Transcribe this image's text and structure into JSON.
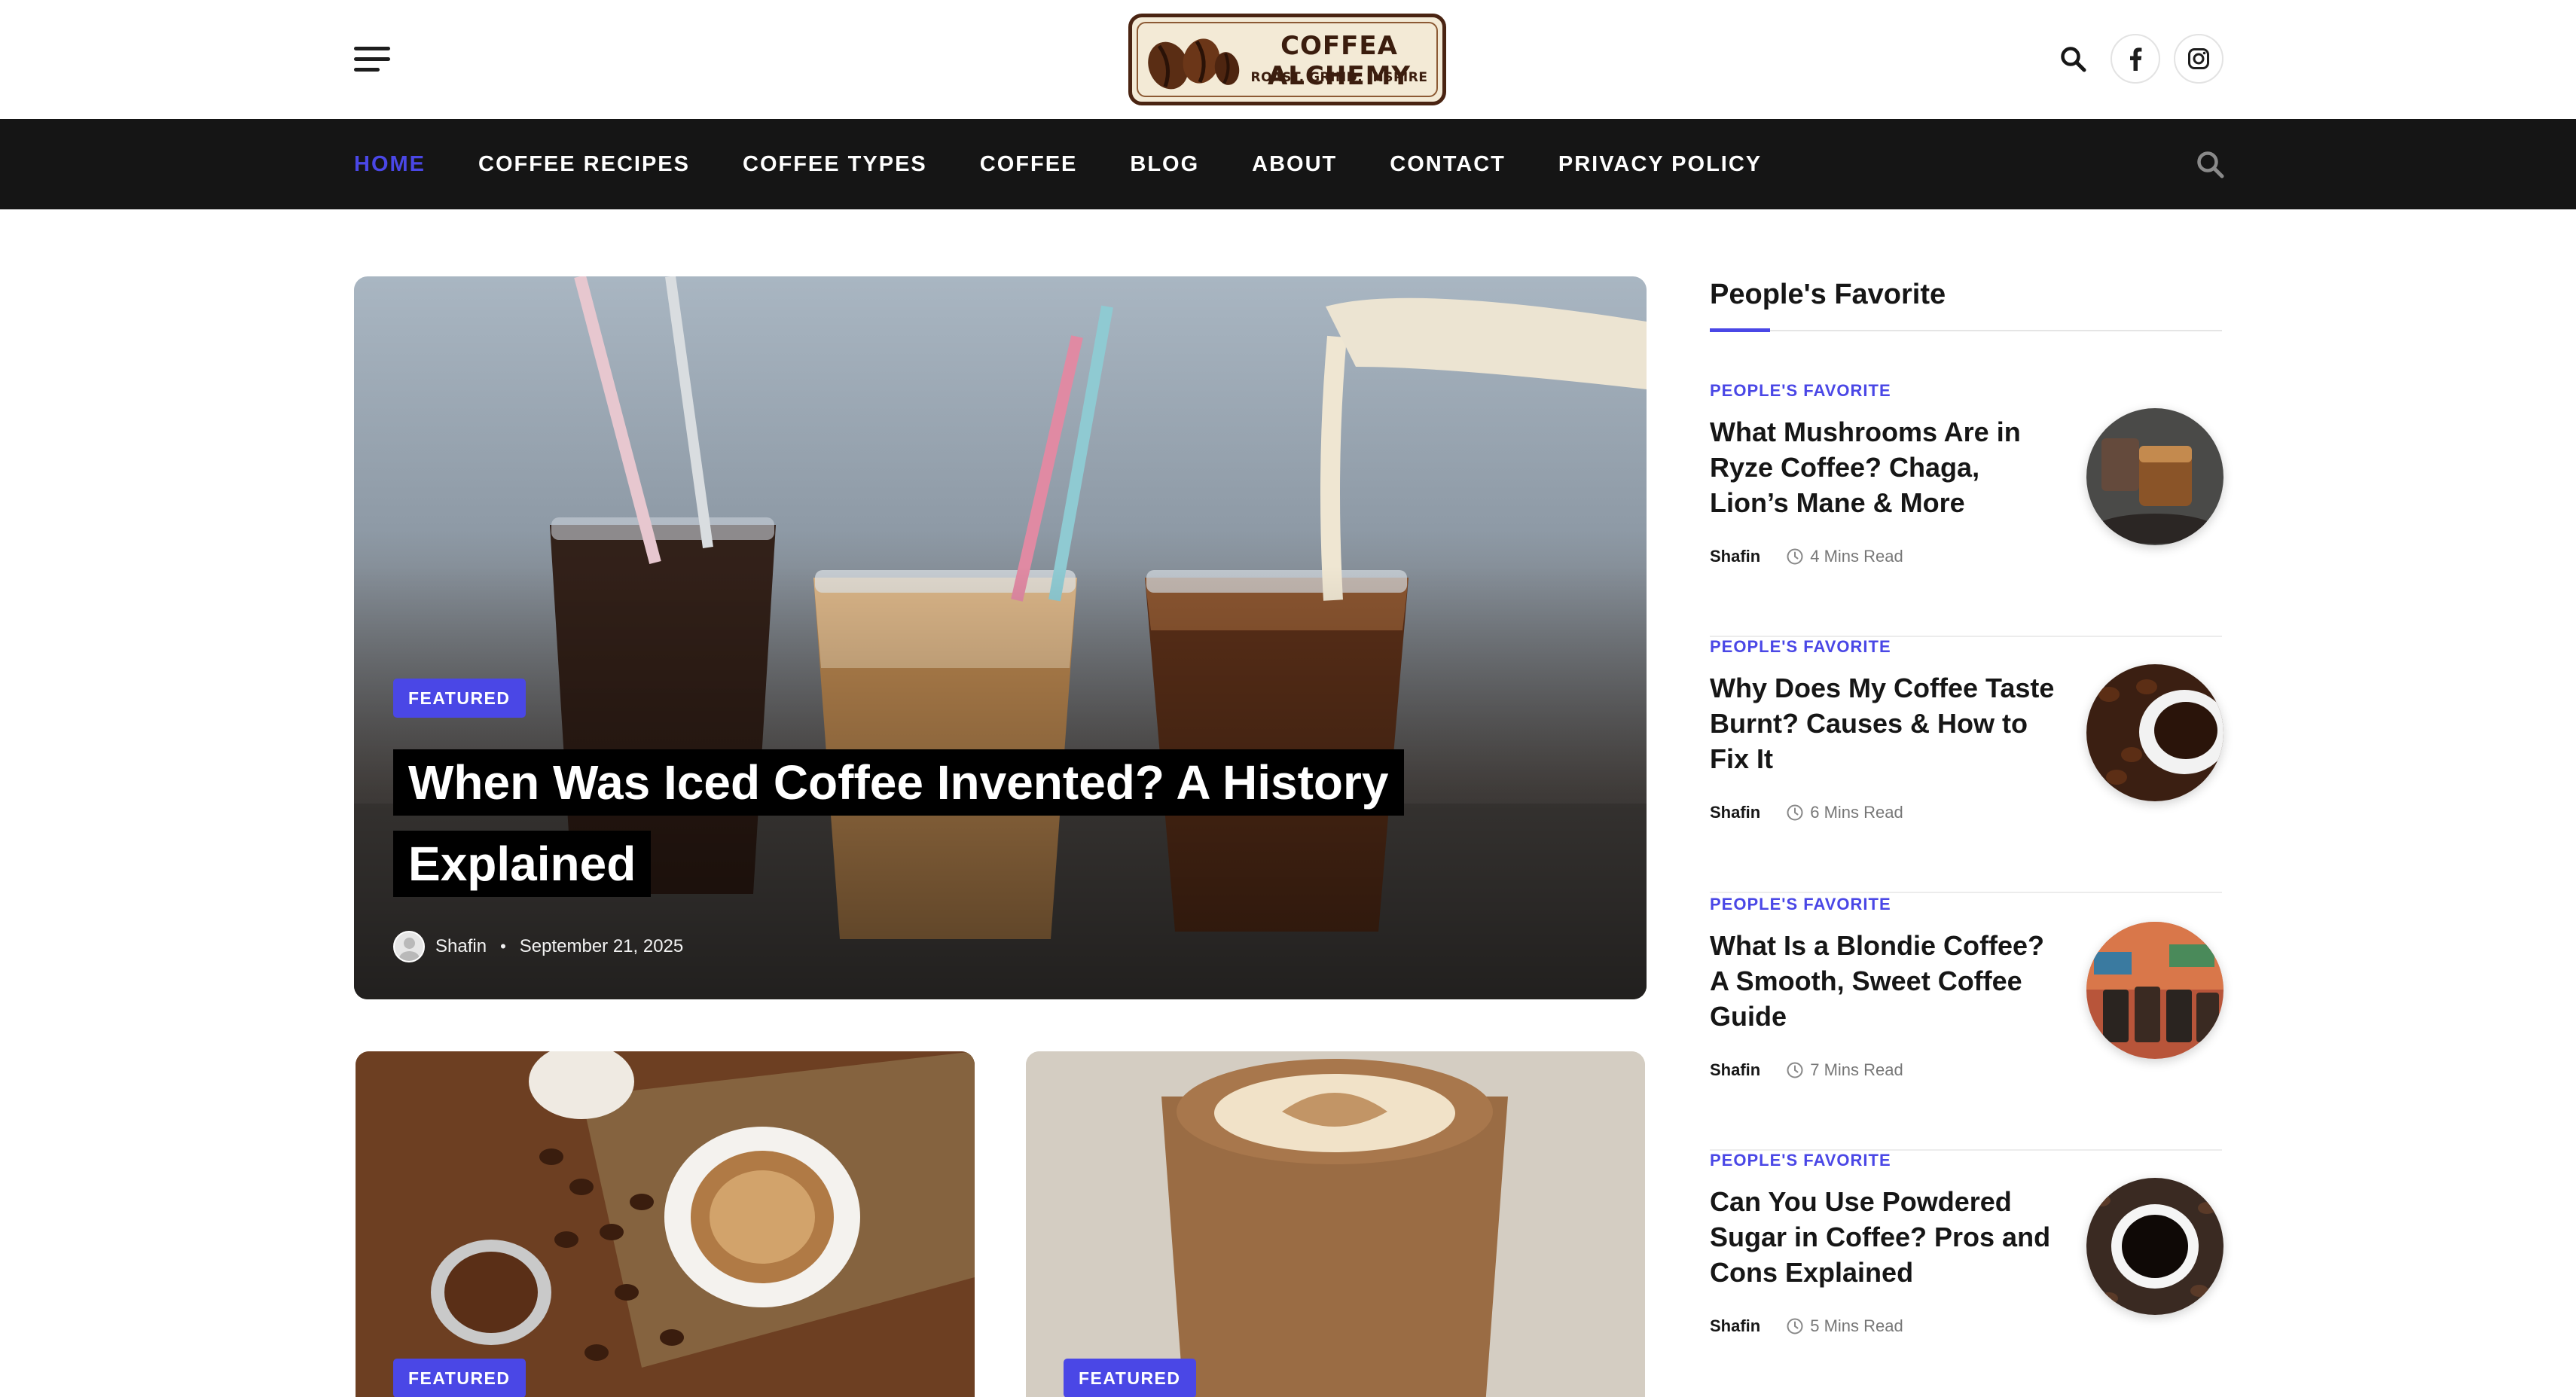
{
  "header": {
    "logo_title": "COFFEA ALCHEMY",
    "logo_tagline": "ROAST, GRIND, INSPIRE",
    "menu_icon": "hamburger-menu-icon",
    "search_icon": "search-icon",
    "social": [
      {
        "name": "facebook",
        "icon": "facebook-icon"
      },
      {
        "name": "instagram",
        "icon": "instagram-icon"
      }
    ]
  },
  "nav": {
    "items": [
      {
        "label": "HOME",
        "active": true
      },
      {
        "label": "COFFEE RECIPES",
        "active": false
      },
      {
        "label": "COFFEE TYPES",
        "active": false
      },
      {
        "label": "COFFEE",
        "active": false
      },
      {
        "label": "BLOG",
        "active": false
      },
      {
        "label": "ABOUT",
        "active": false
      },
      {
        "label": "CONTACT",
        "active": false
      },
      {
        "label": "PRIVACY POLICY",
        "active": false
      }
    ],
    "search_icon": "search-icon"
  },
  "hero": {
    "badge": "FEATURED",
    "title": "When Was Iced Coffee Invented? A History Explained",
    "author": "Shafin",
    "separator": "•",
    "date": "September 21, 2025"
  },
  "cards": [
    {
      "badge": "FEATURED"
    },
    {
      "badge": "FEATURED"
    }
  ],
  "sidebar": {
    "heading": "People's Favorite",
    "items": [
      {
        "category": "PEOPLE'S FAVORITE",
        "title": "What Mushrooms Are in Ryze Coffee? Chaga, Lion’s Mane & More",
        "author": "Shafin",
        "read_time": "4 Mins Read"
      },
      {
        "category": "PEOPLE'S FAVORITE",
        "title": "Why Does My Coffee Taste Burnt? Causes & How to Fix It",
        "author": "Shafin",
        "read_time": "6 Mins Read"
      },
      {
        "category": "PEOPLE'S FAVORITE",
        "title": "What Is a Blondie Coffee? A Smooth, Sweet Coffee Guide",
        "author": "Shafin",
        "read_time": "7 Mins Read"
      },
      {
        "category": "PEOPLE'S FAVORITE",
        "title": "Can You Use Powdered Sugar in Coffee? Pros and Cons Explained",
        "author": "Shafin",
        "read_time": "5 Mins Read"
      }
    ]
  },
  "colors": {
    "accent": "#4a47e6",
    "nav_background": "#151515",
    "text": "#161616"
  }
}
